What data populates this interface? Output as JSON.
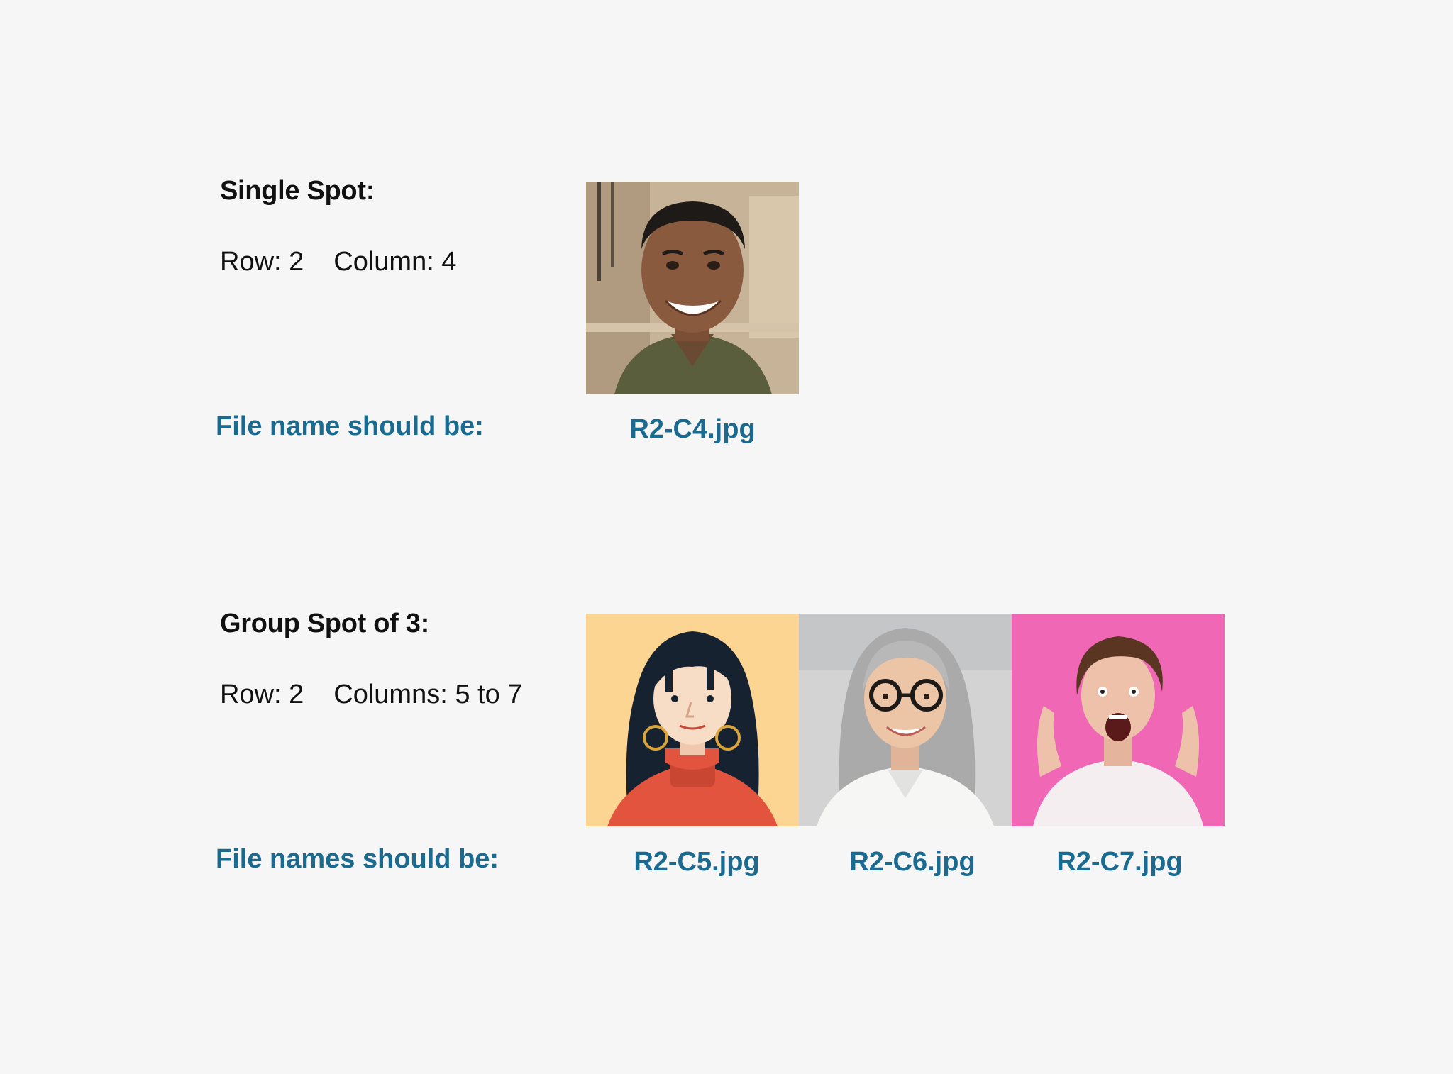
{
  "single": {
    "heading": "Single Spot:",
    "row": "Row: 2",
    "column": "Column: 4",
    "prompt": "File name should be:",
    "filename": "R2-C4.jpg",
    "image": {
      "icon": "smiling-man-portrait",
      "bg": "#c9b49a"
    }
  },
  "group": {
    "heading": "Group Spot of 3:",
    "row": "Row: 2",
    "columns": "Columns: 5 to 7",
    "prompt": "File names should be:",
    "filenames": [
      "R2-C5.jpg",
      "R2-C6.jpg",
      "R2-C7.jpg"
    ],
    "images": [
      {
        "icon": "illustrated-woman-portrait",
        "bg": "#fcd592"
      },
      {
        "icon": "woman-with-glasses-portrait",
        "bg": "#d7d7d7"
      },
      {
        "icon": "surprised-woman-portrait",
        "bg": "#f067b6"
      }
    ]
  },
  "colors": {
    "background": "#f6f6f6",
    "accent": "#1b6a90",
    "text": "#111111"
  }
}
